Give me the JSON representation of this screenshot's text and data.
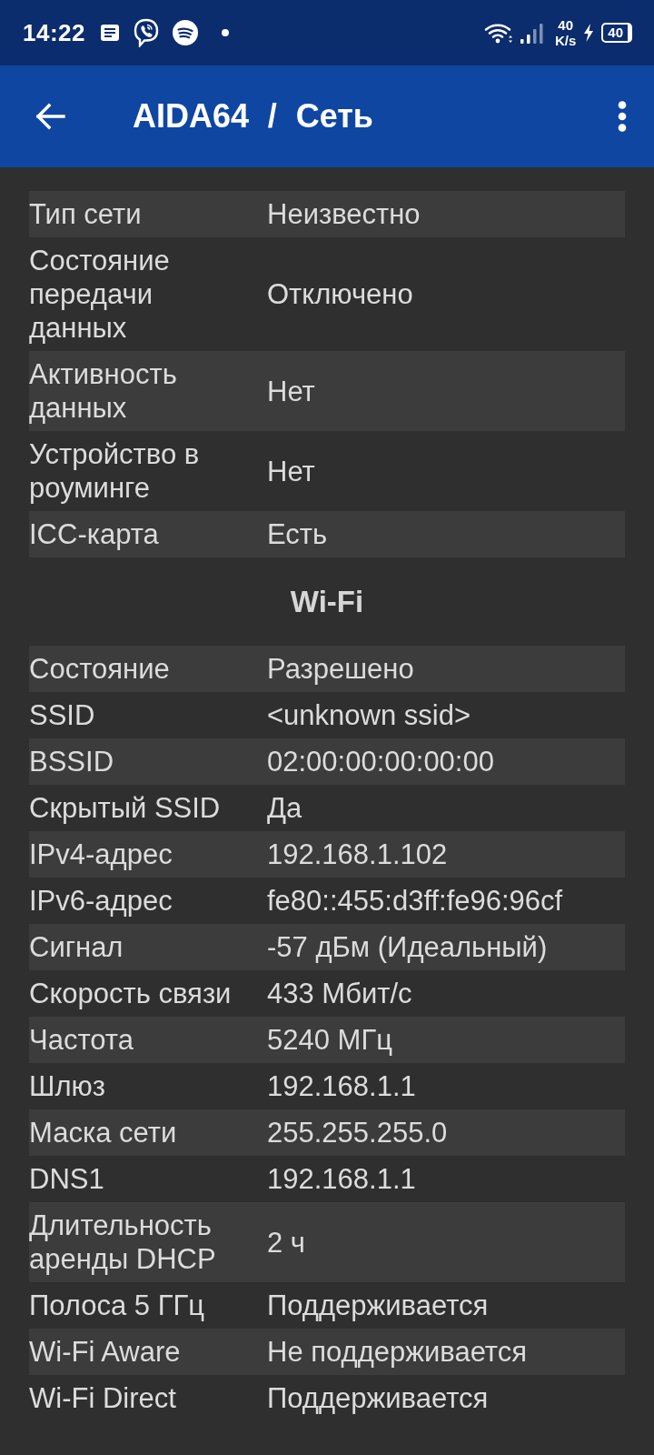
{
  "status_bar": {
    "time": "14:22",
    "network_speed": "40",
    "network_speed_unit": "K/s",
    "battery": "40"
  },
  "app_bar": {
    "title": "AIDA64 / Сеть"
  },
  "sections": [
    {
      "rows": [
        {
          "label": "Тип сети",
          "value": "Неизвестно"
        },
        {
          "label": "Состояние передачи данных",
          "value": "Отключено"
        },
        {
          "label": "Активность данных",
          "value": "Нет"
        },
        {
          "label": "Устройство в роуминге",
          "value": "Нет"
        },
        {
          "label": "ICC-карта",
          "value": "Есть"
        }
      ]
    },
    {
      "heading": "Wi-Fi",
      "rows": [
        {
          "label": "Состояние",
          "value": "Разрешено"
        },
        {
          "label": "SSID",
          "value": "<unknown ssid>"
        },
        {
          "label": "BSSID",
          "value": "02:00:00:00:00:00"
        },
        {
          "label": "Скрытый SSID",
          "value": "Да"
        },
        {
          "label": "IPv4-адрес",
          "value": "192.168.1.102"
        },
        {
          "label": "IPv6-адрес",
          "value": "fe80::455:d3ff:fe96:96cf"
        },
        {
          "label": "Сигнал",
          "value": "-57 дБм (Идеальный)"
        },
        {
          "label": "Скорость связи",
          "value": "433 Мбит/с"
        },
        {
          "label": "Частота",
          "value": "5240 МГц"
        },
        {
          "label": "Шлюз",
          "value": "192.168.1.1"
        },
        {
          "label": "Маска сети",
          "value": "255.255.255.0"
        },
        {
          "label": "DNS1",
          "value": "192.168.1.1"
        },
        {
          "label": "Длительность аренды DHCP",
          "value": "2 ч"
        },
        {
          "label": "Полоса 5 ГГц",
          "value": "Поддерживается"
        },
        {
          "label": "Wi-Fi Aware",
          "value": "Не поддерживается"
        },
        {
          "label": "Wi-Fi Direct",
          "value": "Поддерживается"
        }
      ]
    }
  ]
}
